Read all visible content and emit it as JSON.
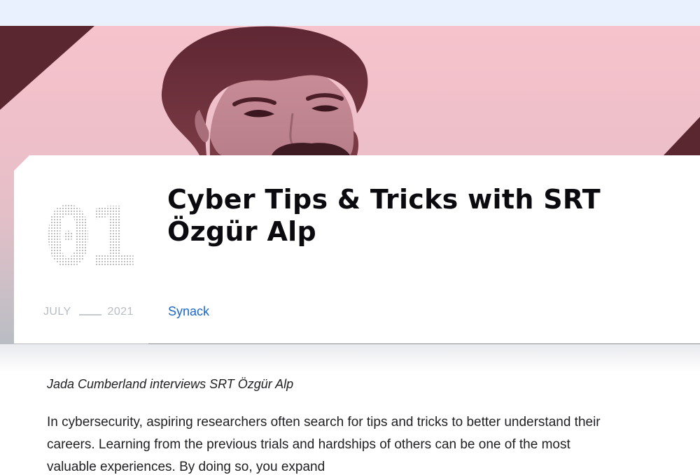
{
  "article": {
    "issue_number": "01",
    "title": "Cyber Tips & Tricks with SRT Özgür Alp",
    "date": {
      "month": "JULY",
      "year": "2021"
    },
    "category": "Synack",
    "byline": "Jada Cumberland interviews SRT Özgür Alp",
    "intro": "In cybersecurity, aspiring researchers often search for tips and tricks to better understand their careers. Learning from the previous trials and hardships of others can be one of the most valuable experiences. By doing so, you expand"
  },
  "hero": {
    "image": "portrait-photo",
    "tint": "#f0b8c4",
    "accent": "#5a2731"
  },
  "colors": {
    "top_bar": "#e8f1fd",
    "link": "#1b66c9",
    "title": "#0b0b0f",
    "muted": "#b8bcc3"
  }
}
